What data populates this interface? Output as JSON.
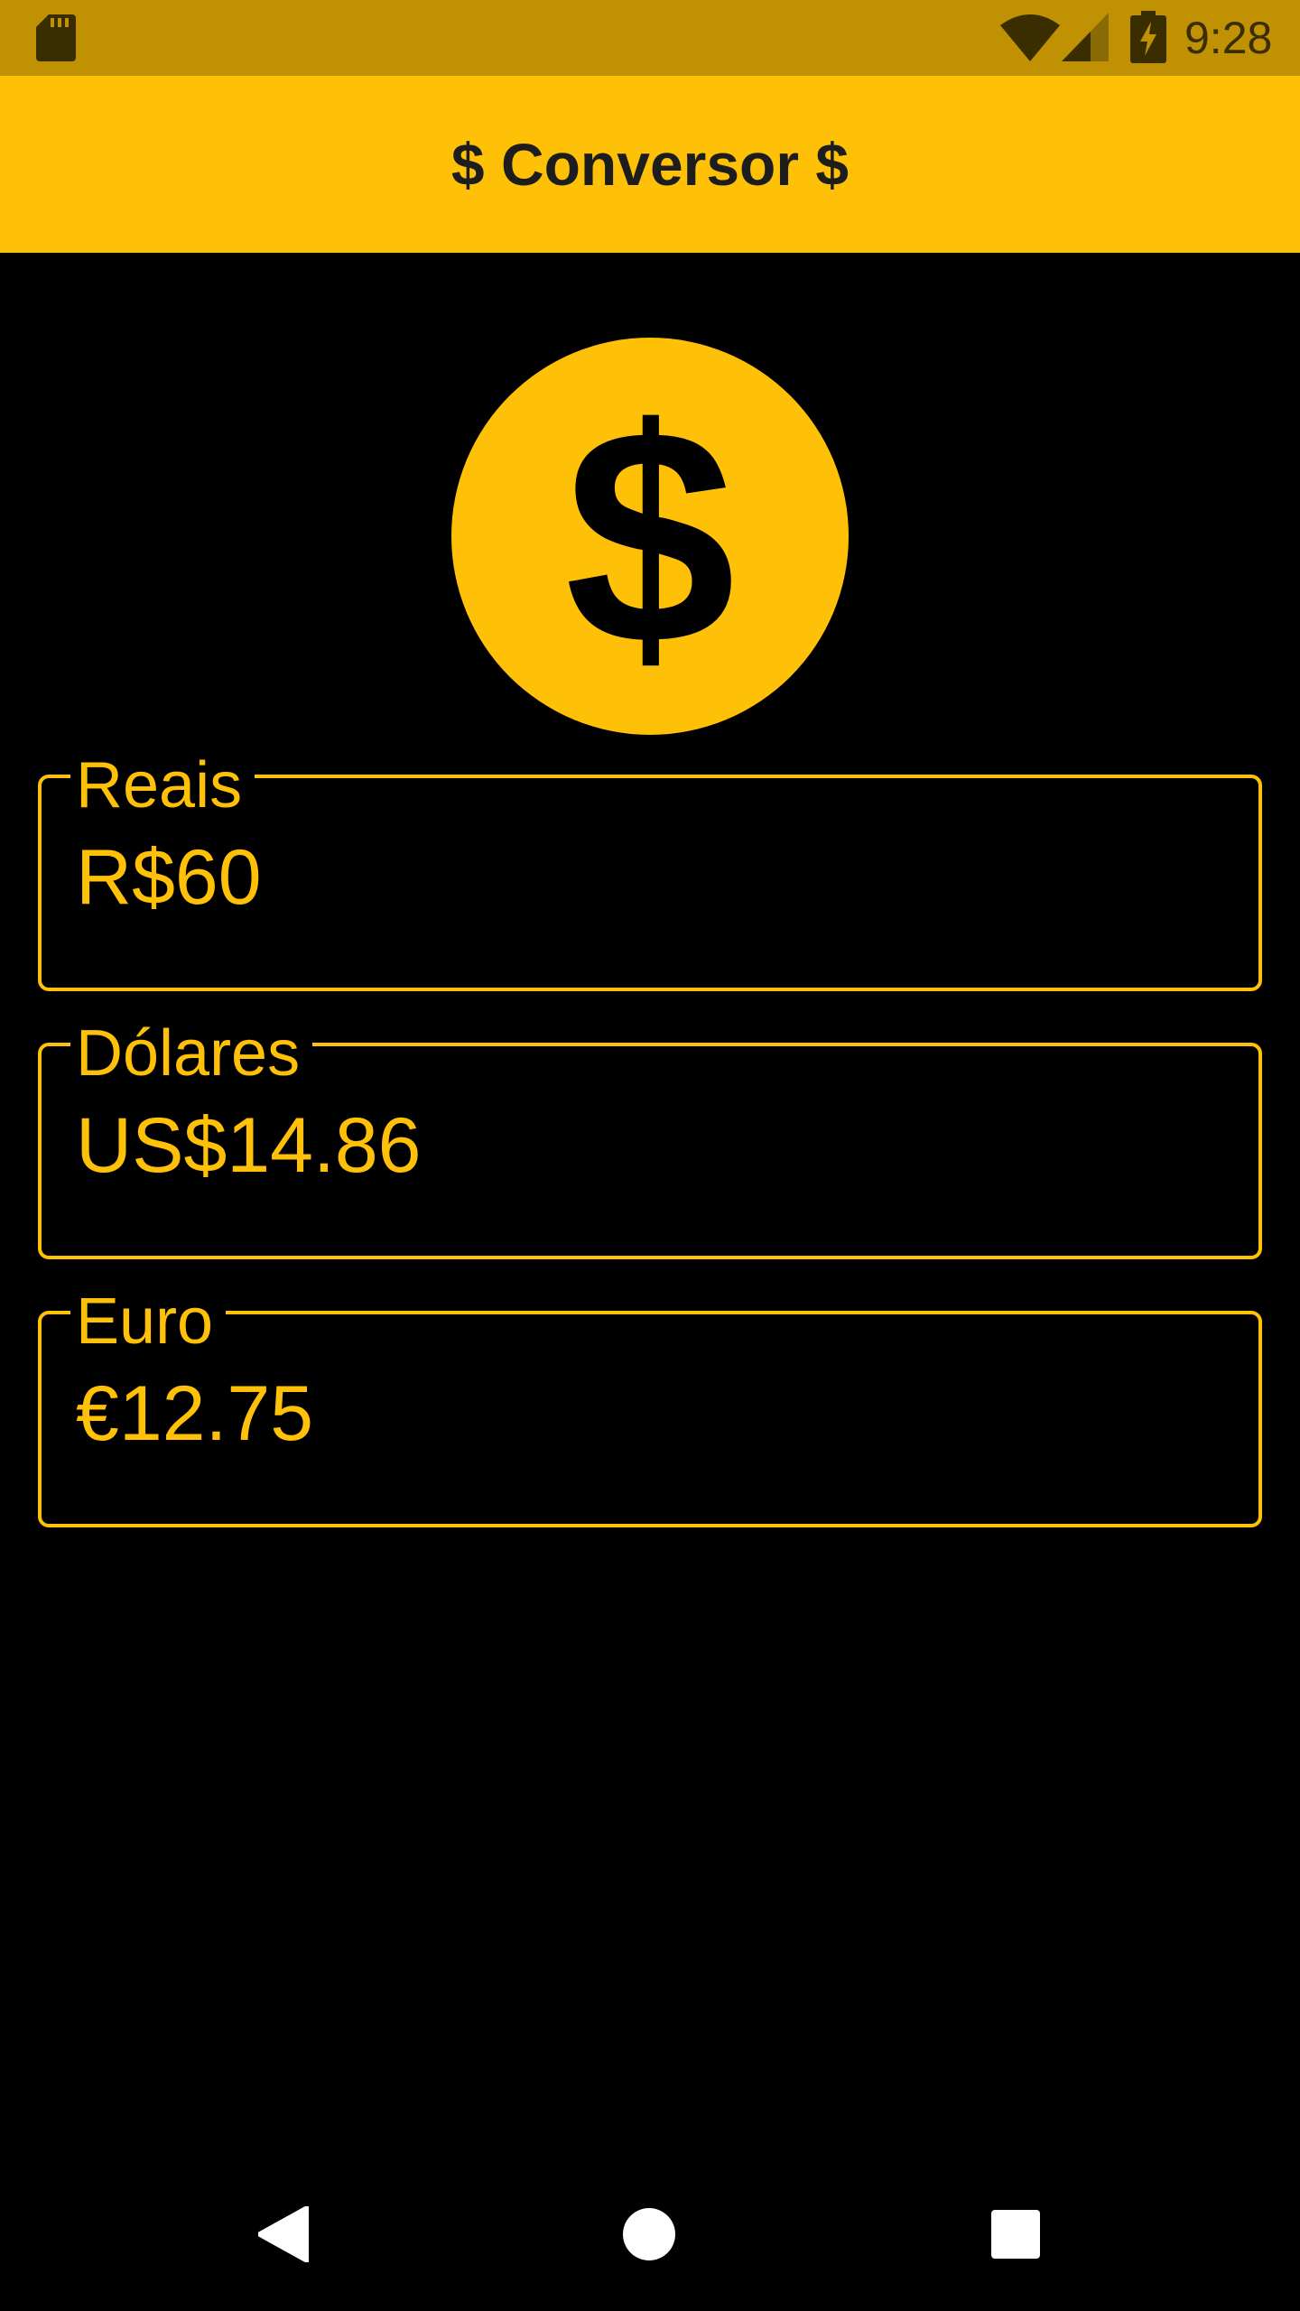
{
  "status_bar": {
    "time": "9:28",
    "icons": [
      "sd-card-icon",
      "wifi-icon",
      "signal-icon",
      "battery-charging-icon"
    ]
  },
  "app_bar": {
    "title": "$ Conversor $"
  },
  "hero_icon": "dollar-coin-icon",
  "fields": [
    {
      "label": "Reais",
      "value": "R$60"
    },
    {
      "label": "Dólares",
      "value": "US$14.86"
    },
    {
      "label": "Euro",
      "value": "€12.75"
    }
  ],
  "nav_bar": {
    "icons": [
      "back-icon",
      "home-icon",
      "recents-icon"
    ]
  },
  "colors": {
    "accent": "#ffc107",
    "status_bar": "#c09102",
    "background": "#000000",
    "title_text": "#1d1d1d"
  }
}
